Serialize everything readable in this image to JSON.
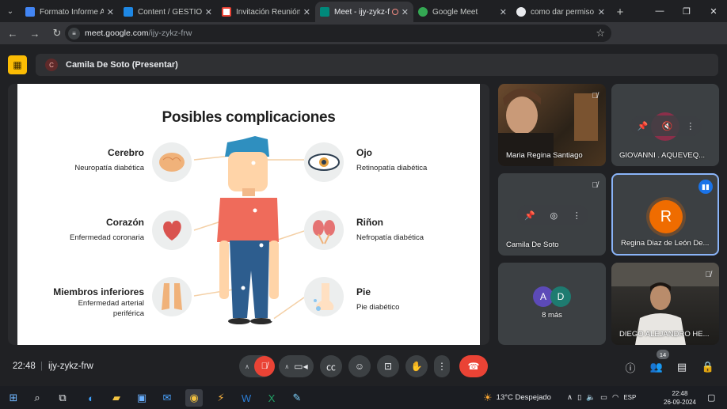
{
  "browser": {
    "tabs": [
      {
        "title": "Formato Informe Act",
        "favicon_color": "#4285f4"
      },
      {
        "title": "Content / GESTION D",
        "favicon_color": "#1e88e5"
      },
      {
        "title": "Invitación Reunión de",
        "favicon_color": "#ea4335"
      },
      {
        "title": "Meet - ijy-zykz-frw",
        "favicon_color": "#00897b",
        "active": true
      },
      {
        "title": "Google Meet",
        "favicon_color": "#34a853"
      },
      {
        "title": "como dar permiso en",
        "favicon_color": "#e8eaed"
      }
    ],
    "url_host": "meet.google.com",
    "url_path": "/ijy-zykz-frw",
    "profile_initial": "D"
  },
  "meet": {
    "presenter_initial": "C",
    "presenter_label": "Camila De Soto (Presentar)",
    "slide": {
      "title": "Posibles complicaciones",
      "items": [
        {
          "heading": "Cerebro",
          "sub": "Neuropatía diabética"
        },
        {
          "heading": "Corazón",
          "sub": "Enfermedad coronaria"
        },
        {
          "heading": "Miembros inferiores",
          "sub": "Enfermedad arterial",
          "sub2": "periférica"
        },
        {
          "heading": "Ojo",
          "sub": "Retinopatía diabética"
        },
        {
          "heading": "Riñon",
          "sub": "Nefropatía diabética"
        },
        {
          "heading": "Pie",
          "sub": "Pie diabético"
        }
      ]
    },
    "participants": [
      {
        "name": "Maria Regina Santiago"
      },
      {
        "name": "GIOVANNI . AQUEVEQ..."
      },
      {
        "name": "Camila De Soto"
      },
      {
        "name": "Regina Diaz de León De...",
        "initial": "R"
      },
      {
        "name": "8 más",
        "initials": [
          "A",
          "D"
        ]
      },
      {
        "name": "DIEGO ALEJANDRO HE..."
      }
    ],
    "time": "22:48",
    "meeting_code": "ijy-zykz-frw",
    "participant_count": "14"
  },
  "taskbar": {
    "weather": "13°C  Despejado",
    "language": "ESP",
    "clock_time": "22:48",
    "clock_date": "26-09-2024"
  }
}
